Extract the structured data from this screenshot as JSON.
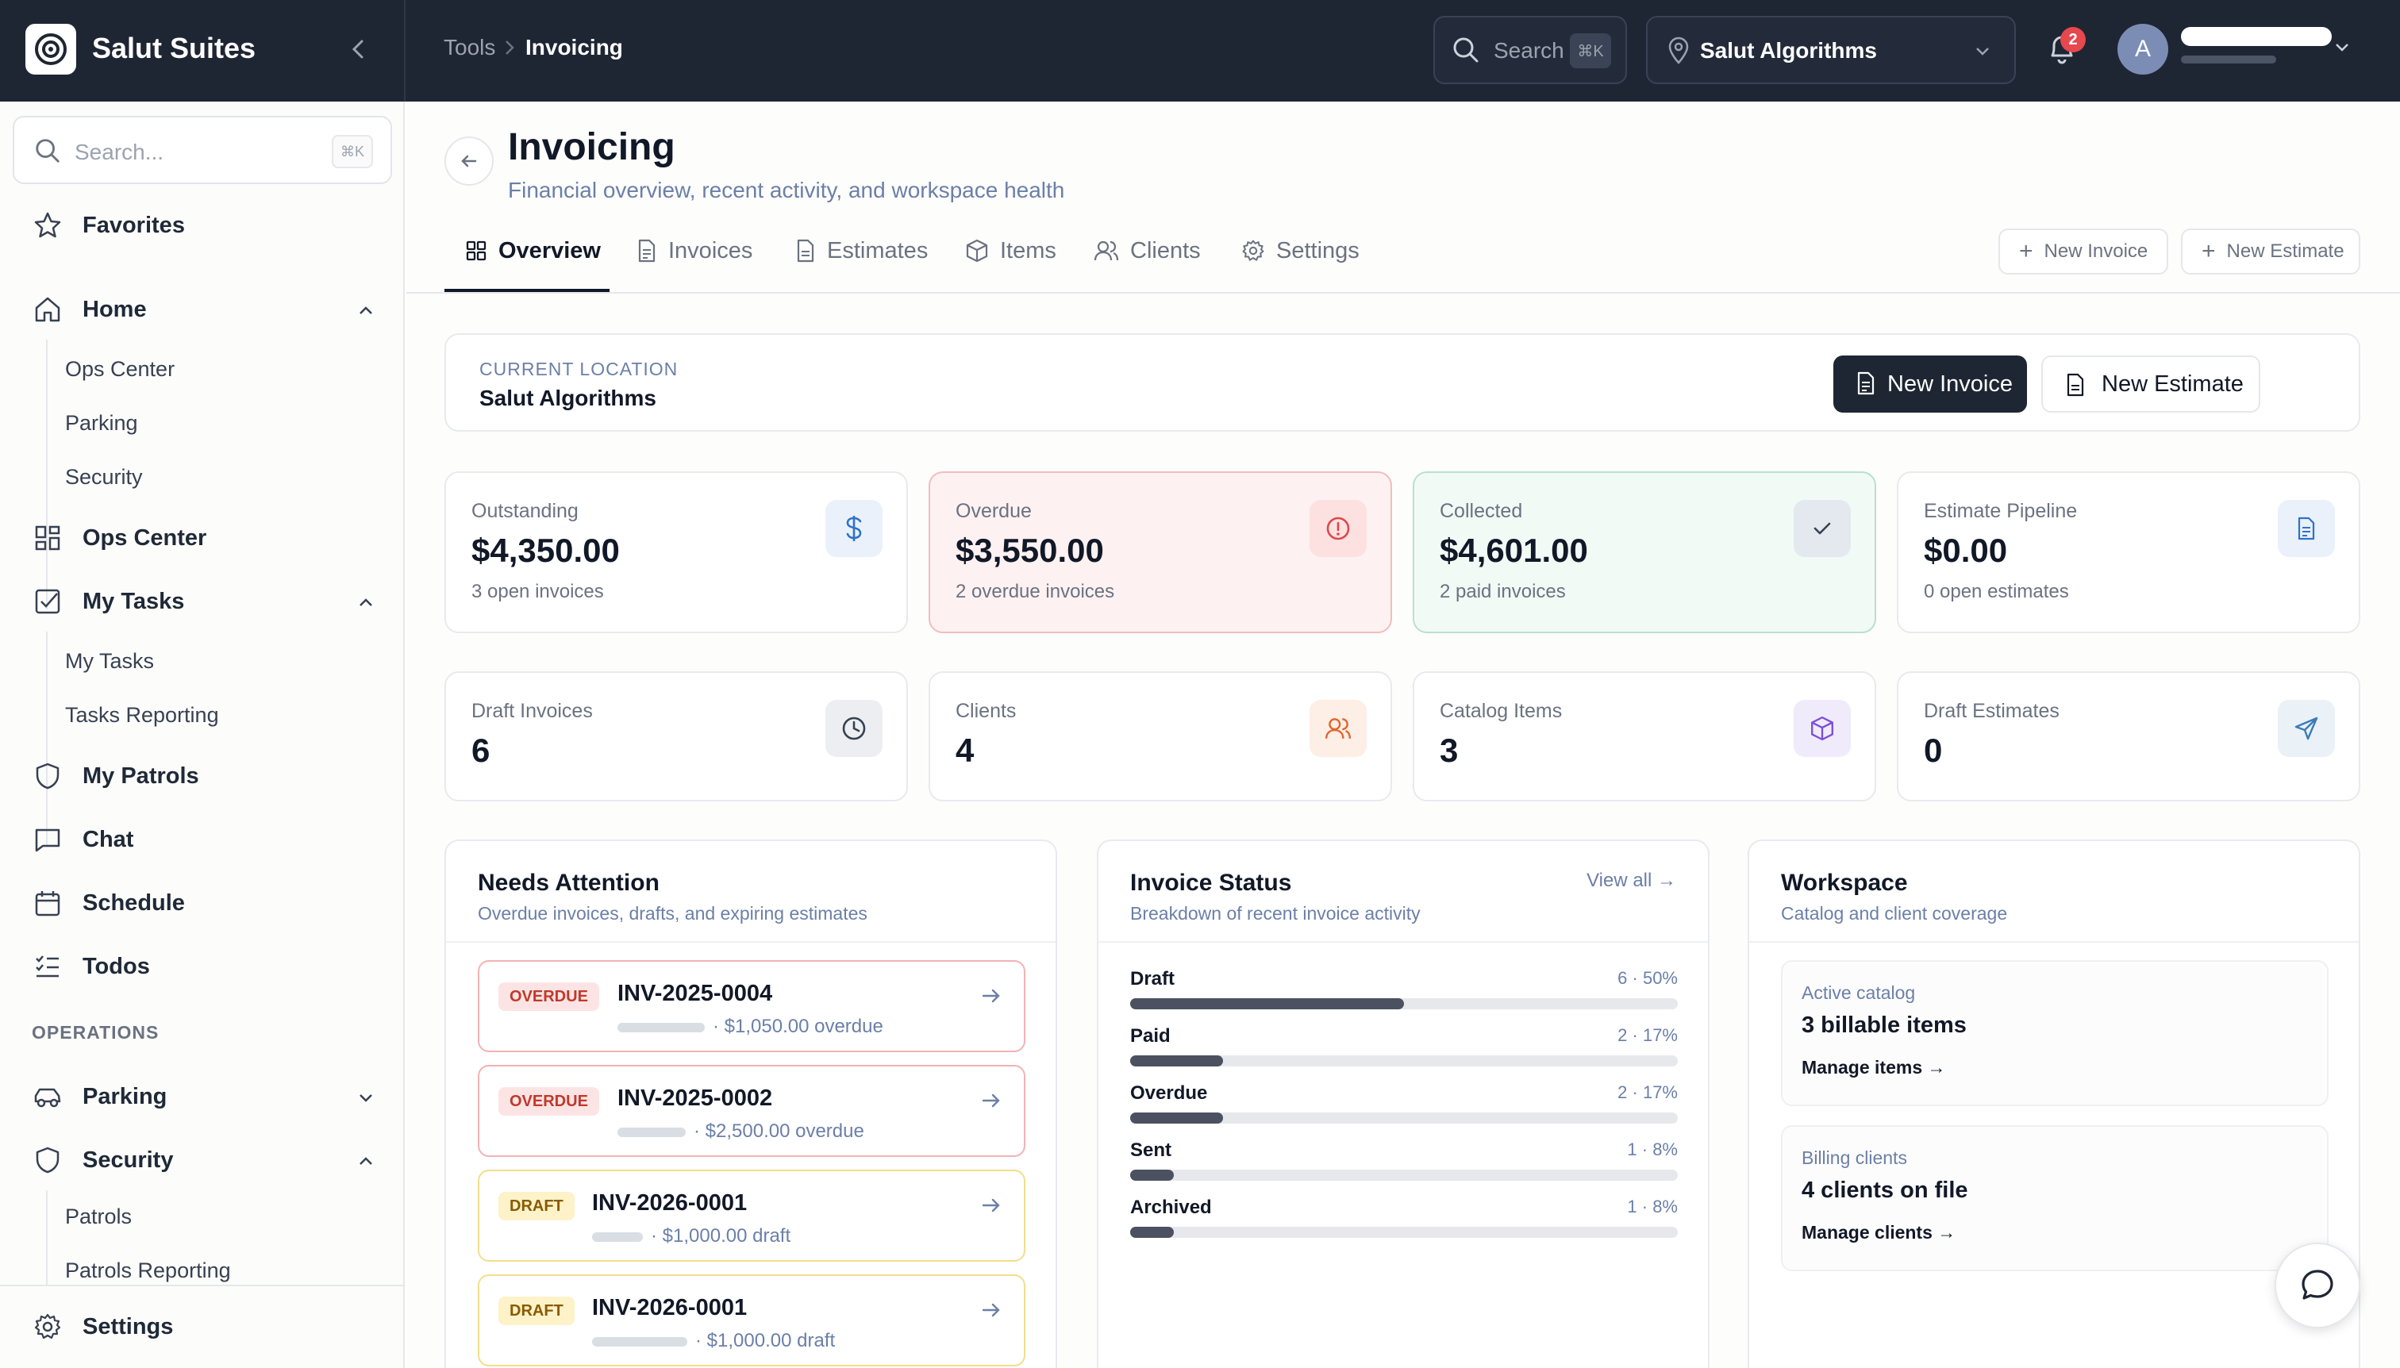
{
  "app": {
    "brand": "Salut Suites"
  },
  "topbar": {
    "breadcrumb": [
      "Tools",
      "Invoicing"
    ],
    "search_label": "Search",
    "search_shortcut": "⌘K",
    "location": "Salut Algorithms",
    "notification_count": "2",
    "avatar_initial": "A"
  },
  "sidebar": {
    "search_placeholder": "Search...",
    "search_shortcut": "⌘K",
    "items": {
      "favorites": "Favorites",
      "home": "Home",
      "home_sub": [
        "Ops Center",
        "Parking",
        "Security"
      ],
      "ops_center": "Ops Center",
      "my_tasks": "My Tasks",
      "my_tasks_sub": [
        "My Tasks",
        "Tasks Reporting"
      ],
      "my_patrols": "My Patrols",
      "chat": "Chat",
      "schedule": "Schedule",
      "todos": "Todos"
    },
    "operations_heading": "OPERATIONS",
    "operations": {
      "parking": "Parking",
      "security": "Security",
      "security_sub": [
        "Patrols",
        "Patrols Reporting"
      ]
    },
    "settings": "Settings"
  },
  "page": {
    "title": "Invoicing",
    "subtitle": "Financial overview, recent activity, and workspace health",
    "tabs": [
      "Overview",
      "Invoices",
      "Estimates",
      "Items",
      "Clients",
      "Settings"
    ],
    "header_buttons": {
      "new_invoice": "New Invoice",
      "new_estimate": "New Estimate"
    }
  },
  "location_card": {
    "caption": "CURRENT LOCATION",
    "name": "Salut Algorithms",
    "new_invoice": "New Invoice",
    "new_estimate": "New Estimate"
  },
  "stats": [
    {
      "label": "Outstanding",
      "value": "$4,350.00",
      "sub": "3 open invoices"
    },
    {
      "label": "Overdue",
      "value": "$3,550.00",
      "sub": "2 overdue invoices"
    },
    {
      "label": "Collected",
      "value": "$4,601.00",
      "sub": "2 paid invoices"
    },
    {
      "label": "Estimate Pipeline",
      "value": "$0.00",
      "sub": "0 open estimates"
    },
    {
      "label": "Draft Invoices",
      "value": "6"
    },
    {
      "label": "Clients",
      "value": "4"
    },
    {
      "label": "Catalog Items",
      "value": "3"
    },
    {
      "label": "Draft Estimates",
      "value": "0"
    }
  ],
  "needs_attention": {
    "title": "Needs Attention",
    "subtitle": "Overdue invoices, drafts, and expiring estimates",
    "items": [
      {
        "status": "OVERDUE",
        "number": "INV-2025-0004",
        "detail": "· $1,050.00 overdue"
      },
      {
        "status": "OVERDUE",
        "number": "INV-2025-0002",
        "detail": "· $2,500.00 overdue"
      },
      {
        "status": "DRAFT",
        "number": "INV-2026-0001",
        "detail": "· $1,000.00 draft"
      },
      {
        "status": "DRAFT",
        "number": "INV-2026-0001",
        "detail": "· $1,000.00 draft"
      }
    ]
  },
  "invoice_status": {
    "title": "Invoice Status",
    "subtitle": "Breakdown of recent invoice activity",
    "view_all": "View all →",
    "rows": [
      {
        "name": "Draft",
        "count": "6 · 50%",
        "fraction": 0.5
      },
      {
        "name": "Paid",
        "count": "2 · 17%",
        "fraction": 0.17
      },
      {
        "name": "Overdue",
        "count": "2 · 17%",
        "fraction": 0.17
      },
      {
        "name": "Sent",
        "count": "1 · 8%",
        "fraction": 0.08
      },
      {
        "name": "Archived",
        "count": "1 · 8%",
        "fraction": 0.08
      }
    ]
  },
  "workspace": {
    "title": "Workspace",
    "subtitle": "Catalog and client coverage",
    "cards": [
      {
        "caption": "Active catalog",
        "value": "3 billable items",
        "link": "Manage items →"
      },
      {
        "caption": "Billing clients",
        "value": "4 clients on file",
        "link": "Manage clients →"
      }
    ]
  }
}
